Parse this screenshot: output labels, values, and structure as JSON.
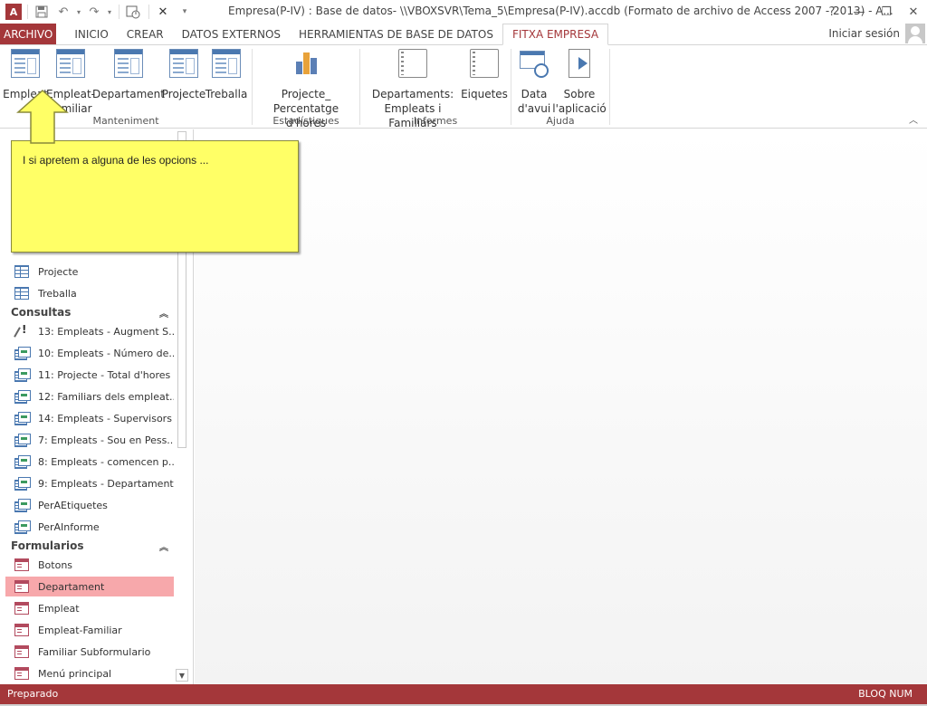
{
  "app": {
    "title": "Empresa(P-IV) : Base de datos- \\\\VBOXSVR\\Tema_5\\Empresa(P-IV).accdb (Formato de archivo de Access 2007 - 2013) - A...",
    "accent_color": "#a4373a"
  },
  "qat": {
    "items": [
      "access-logo-icon",
      "save-icon",
      "undo-icon",
      "redo-icon",
      "touch-mode-icon",
      "close-db-icon",
      "customize-qat-icon"
    ]
  },
  "window": {
    "help": "?",
    "minimize": "—",
    "restore": "❐",
    "close": "✕"
  },
  "tabs": {
    "file": "ARCHIVO",
    "items": [
      "INICIO",
      "CREAR",
      "DATOS EXTERNOS",
      "HERRAMIENTAS DE BASE DE DATOS",
      "FITXA EMPRESA"
    ],
    "active": "FITXA EMPRESA",
    "signin": "Iniciar sesión"
  },
  "ribbon": {
    "groups": [
      {
        "label": "Manteniment",
        "buttons": [
          {
            "line1": "Empleat",
            "line2": ""
          },
          {
            "line1": "Empleat-",
            "line2": "Familiar"
          },
          {
            "line1": "Departament",
            "line2": ""
          },
          {
            "line1": "Projecte",
            "line2": ""
          },
          {
            "line1": "Treballa",
            "line2": ""
          }
        ]
      },
      {
        "label": "Estadístiques",
        "buttons": [
          {
            "line1": "Projecte_",
            "line2": "Percentatge d'hores"
          }
        ]
      },
      {
        "label": "Informes",
        "buttons": [
          {
            "line1": "Departaments:",
            "line2": "Empleats i Familiars"
          },
          {
            "line1": "Eiquetes",
            "line2": ""
          }
        ]
      },
      {
        "label": "Ajuda",
        "buttons": [
          {
            "line1": "Data",
            "line2": "d'avui"
          },
          {
            "line1": "Sobre",
            "line2": "l'aplicació"
          }
        ]
      }
    ]
  },
  "nav": {
    "tables_visible": [
      "Projecte",
      "Treballa"
    ],
    "queries_header": "Consultas",
    "queries": [
      "13: Empleats - Augment S...",
      "10: Empleats - Número de...",
      "11: Projecte - Total d'hores",
      "12: Familiars dels empleat...",
      "14: Empleats - Supervisors",
      "7: Empleats - Sou en Pess...",
      "8: Empleats - comencen p...",
      "9: Empleats - Departaments",
      "PerAEtiquetes",
      "PerAInforme"
    ],
    "forms_header": "Formularios",
    "forms": [
      "Botons",
      "Departament",
      "Empleat",
      "Empleat-Familiar",
      "Familiar Subformulario",
      "Menú principal"
    ],
    "selected_form": "Departament"
  },
  "callout": {
    "text": "I si apretem a alguna de les opcions ..."
  },
  "status": {
    "left": "Preparado",
    "right": "BLOQ NUM"
  }
}
